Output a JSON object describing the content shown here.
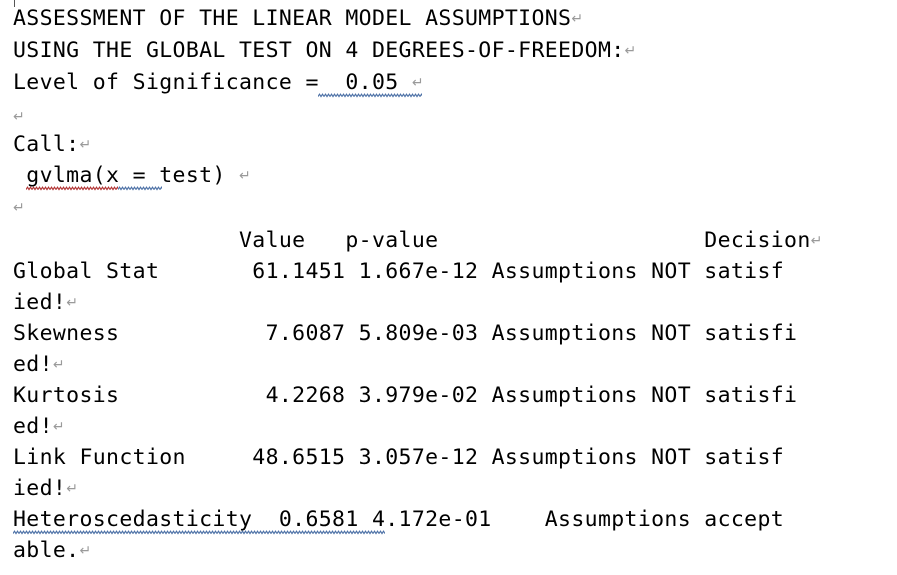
{
  "document": {
    "background_color": "#ffffff",
    "text_color": "#000000",
    "formatting_mark": "↵",
    "formatting_mark_color": "#9a9a9a",
    "spellcheck_color": "#b03030",
    "grammarcheck_color": "#4a6fa5"
  },
  "heading": {
    "line1": "ASSESSMENT OF THE LINEAR MODEL ASSUMPTIONS",
    "line2": "USING THE GLOBAL TEST ON 4 DEGREES-OF-FREEDOM:",
    "line3": "Level of Significance =  0.05 "
  },
  "call": {
    "label": "Call:",
    "expression": " gvlma(x = test) "
  },
  "table": {
    "header": "                 Value   p-value                    Decision",
    "columns": [
      "",
      "Value",
      "p-value",
      "Decision"
    ],
    "rows": [
      {
        "name": "Global Stat",
        "value": "61.1451",
        "p_value": "1.667e-12",
        "decision": "Assumptions NOT satisfied!",
        "line1": "Global Stat       61.1451 1.667e-12 Assumptions NOT satisf",
        "line2": "ied!"
      },
      {
        "name": "Skewness",
        "value": "7.6087",
        "p_value": "5.809e-03",
        "decision": "Assumptions NOT satisfied!",
        "line1": "Skewness           7.6087 5.809e-03 Assumptions NOT satisfi",
        "line2": "ed!"
      },
      {
        "name": "Kurtosis",
        "value": "4.2268",
        "p_value": "3.979e-02",
        "decision": "Assumptions NOT satisfied!",
        "line1": "Kurtosis           4.2268 3.979e-02 Assumptions NOT satisfi",
        "line2": "ed!"
      },
      {
        "name": "Link Function",
        "value": "48.6515",
        "p_value": "3.057e-12",
        "decision": "Assumptions NOT satisfied!",
        "line1": "Link Function     48.6515 3.057e-12 Assumptions NOT satisf",
        "line2": "ied!"
      },
      {
        "name": "Heteroscedasticity",
        "value": "0.6581",
        "p_value": "4.172e-01",
        "decision": "Assumptions acceptable.",
        "line1": "Heteroscedasticity  0.6581 4.172e-01    Assumptions accept",
        "line2": "able."
      }
    ]
  }
}
